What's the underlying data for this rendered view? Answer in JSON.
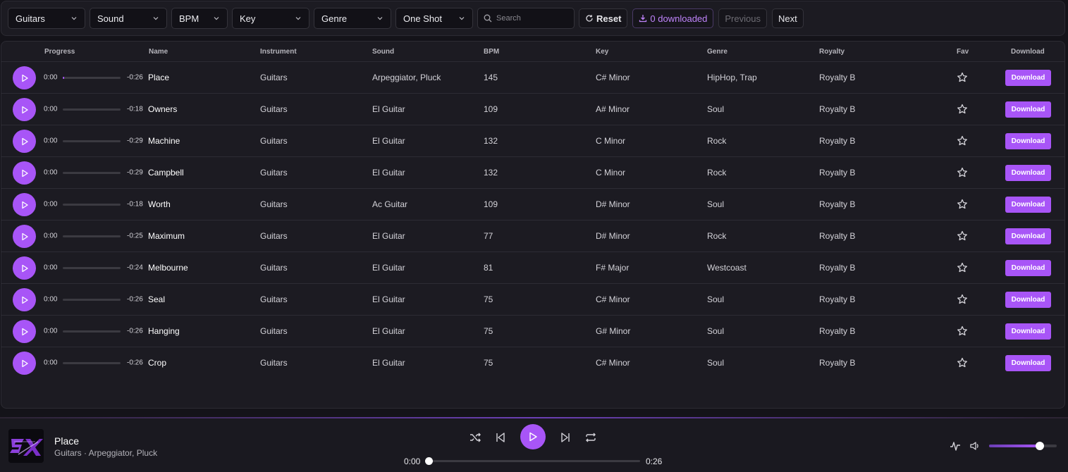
{
  "filters": [
    {
      "label": "Guitars",
      "width": 110
    },
    {
      "label": "Sound",
      "width": 110
    },
    {
      "label": "BPM",
      "width": 80
    },
    {
      "label": "Key",
      "width": 110
    },
    {
      "label": "Genre",
      "width": 110
    },
    {
      "label": "One Shot",
      "width": 110
    }
  ],
  "search": {
    "placeholder": "Search"
  },
  "buttons": {
    "reset": "Reset",
    "downloaded": "0 downloaded",
    "previous": "Previous",
    "next": "Next"
  },
  "columns": {
    "progress": "Progress",
    "name": "Name",
    "instrument": "Instrument",
    "sound": "Sound",
    "bpm": "BPM",
    "key": "Key",
    "genre": "Genre",
    "royalty": "Royalty",
    "fav": "Fav",
    "download": "Download"
  },
  "rows": [
    {
      "cur": "0:00",
      "remain": "-0:26",
      "progress": 0.02,
      "name": "Place",
      "instrument": "Guitars",
      "sound": "Arpeggiator, Pluck",
      "bpm": "145",
      "key": "C# Minor",
      "genre": "HipHop, Trap",
      "royalty": "Royalty B",
      "download": "Download"
    },
    {
      "cur": "0:00",
      "remain": "-0:18",
      "progress": 0,
      "name": "Owners",
      "instrument": "Guitars",
      "sound": "El Guitar",
      "bpm": "109",
      "key": "A# Minor",
      "genre": "Soul",
      "royalty": "Royalty B",
      "download": "Download"
    },
    {
      "cur": "0:00",
      "remain": "-0:29",
      "progress": 0,
      "name": "Machine",
      "instrument": "Guitars",
      "sound": "El Guitar",
      "bpm": "132",
      "key": "C Minor",
      "genre": "Rock",
      "royalty": "Royalty B",
      "download": "Download"
    },
    {
      "cur": "0:00",
      "remain": "-0:29",
      "progress": 0,
      "name": "Campbell",
      "instrument": "Guitars",
      "sound": "El Guitar",
      "bpm": "132",
      "key": "C Minor",
      "genre": "Rock",
      "royalty": "Royalty B",
      "download": "Download"
    },
    {
      "cur": "0:00",
      "remain": "-0:18",
      "progress": 0,
      "name": "Worth",
      "instrument": "Guitars",
      "sound": "Ac Guitar",
      "bpm": "109",
      "key": "D# Minor",
      "genre": "Soul",
      "royalty": "Royalty B",
      "download": "Download"
    },
    {
      "cur": "0:00",
      "remain": "-0:25",
      "progress": 0,
      "name": "Maximum",
      "instrument": "Guitars",
      "sound": "El Guitar",
      "bpm": "77",
      "key": "D# Minor",
      "genre": "Rock",
      "royalty": "Royalty B",
      "download": "Download"
    },
    {
      "cur": "0:00",
      "remain": "-0:24",
      "progress": 0,
      "name": "Melbourne",
      "instrument": "Guitars",
      "sound": "El Guitar",
      "bpm": "81",
      "key": "F# Major",
      "genre": "Westcoast",
      "royalty": "Royalty B",
      "download": "Download"
    },
    {
      "cur": "0:00",
      "remain": "-0:26",
      "progress": 0,
      "name": "Seal",
      "instrument": "Guitars",
      "sound": "El Guitar",
      "bpm": "75",
      "key": "C# Minor",
      "genre": "Soul",
      "royalty": "Royalty B",
      "download": "Download"
    },
    {
      "cur": "0:00",
      "remain": "-0:26",
      "progress": 0,
      "name": "Hanging",
      "instrument": "Guitars",
      "sound": "El Guitar",
      "bpm": "75",
      "key": "G# Minor",
      "genre": "Soul",
      "royalty": "Royalty B",
      "download": "Download"
    },
    {
      "cur": "0:00",
      "remain": "-0:26",
      "progress": 0,
      "name": "Crop",
      "instrument": "Guitars",
      "sound": "El Guitar",
      "bpm": "75",
      "key": "C# Minor",
      "genre": "Soul",
      "royalty": "Royalty B",
      "download": "Download"
    }
  ],
  "player": {
    "title": "Place",
    "subtitle": "Guitars · Arpeggiator, Pluck",
    "current_time": "0:00",
    "duration": "0:26",
    "seek_progress": 0,
    "volume": 0.75
  },
  "colors": {
    "accent": "#a855f7",
    "background": "#141319",
    "panel": "#1c1b22"
  }
}
